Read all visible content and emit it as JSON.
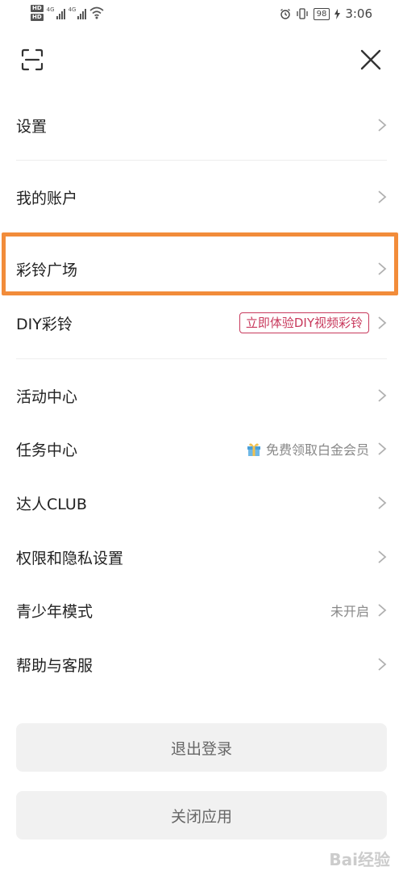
{
  "status_bar": {
    "hd1": "HD",
    "hd2": "HD",
    "net1": "4G",
    "net2": "4G",
    "battery": "98",
    "time": "3:06"
  },
  "header": {
    "scan_icon": "scan-icon",
    "close_icon": "close-icon"
  },
  "menu": {
    "settings": "设置",
    "account": "我的账户",
    "ringtone_plaza": "彩铃广场",
    "diy_ringtone": "DIY彩铃",
    "diy_badge": "立即体验DIY视频彩铃",
    "activity_center": "活动中心",
    "task_center": "任务中心",
    "task_hint": "免费领取白金会员",
    "club": "达人CLUB",
    "privacy": "权限和隐私设置",
    "youth_mode": "青少年模式",
    "youth_status": "未开启",
    "help": "帮助与客服"
  },
  "buttons": {
    "logout": "退出登录",
    "close_app": "关闭应用"
  },
  "watermark": "Bai经验",
  "colors": {
    "accent_pink": "#c8395c",
    "highlight_orange": "#f28c3a"
  }
}
